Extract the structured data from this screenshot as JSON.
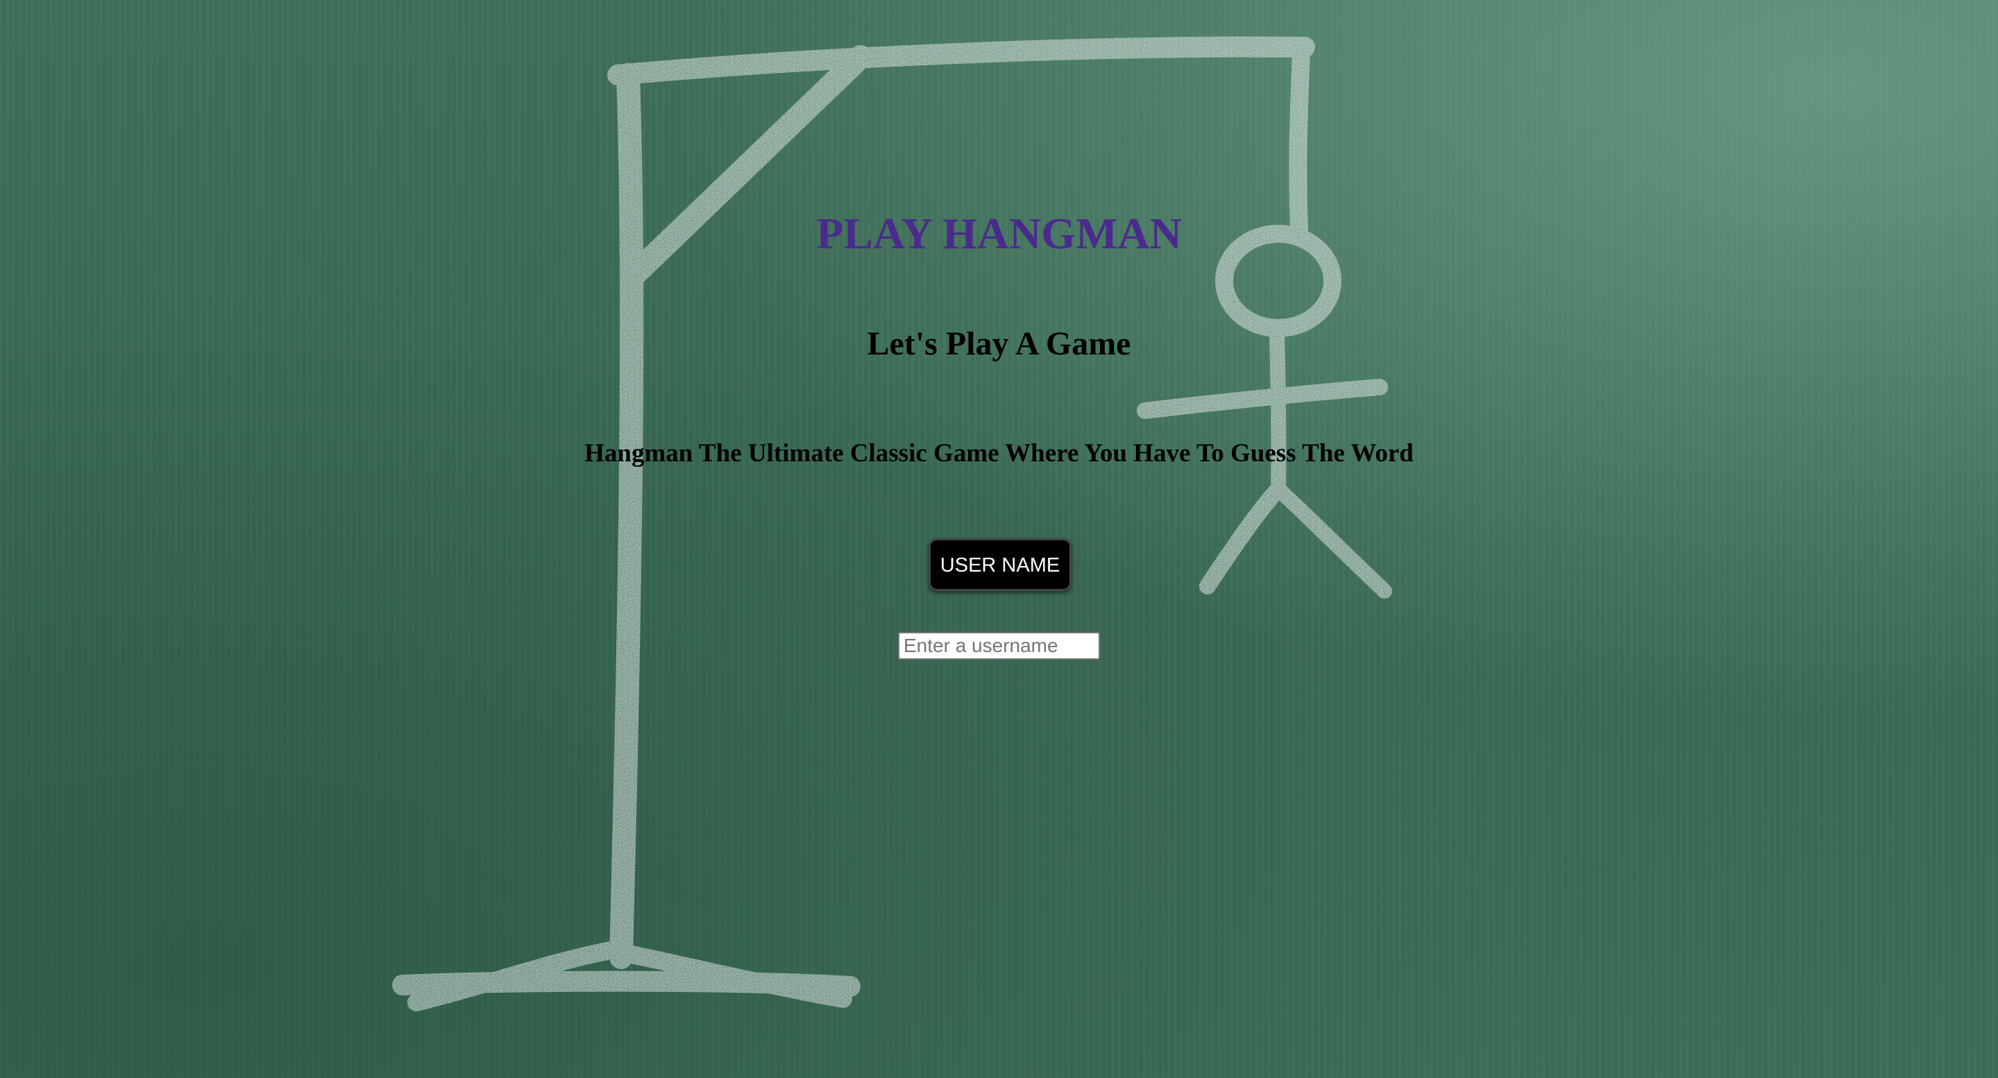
{
  "page": {
    "title": "PLAY HANGMAN",
    "subtitle": "Let's Play A Game",
    "tagline": "Hangman The Ultimate Classic Game Where You Have To Guess The Word"
  },
  "form": {
    "username_button_label": "USER NAME",
    "username_placeholder": "Enter a username",
    "username_value": ""
  },
  "colors": {
    "title": "#4a2a8c",
    "chalkboard": "#3d6e58",
    "chalk": "#eef1f0",
    "button_bg": "#000000",
    "button_text": "#ffffff"
  },
  "background": {
    "image": "chalkboard-hangman-drawing"
  }
}
